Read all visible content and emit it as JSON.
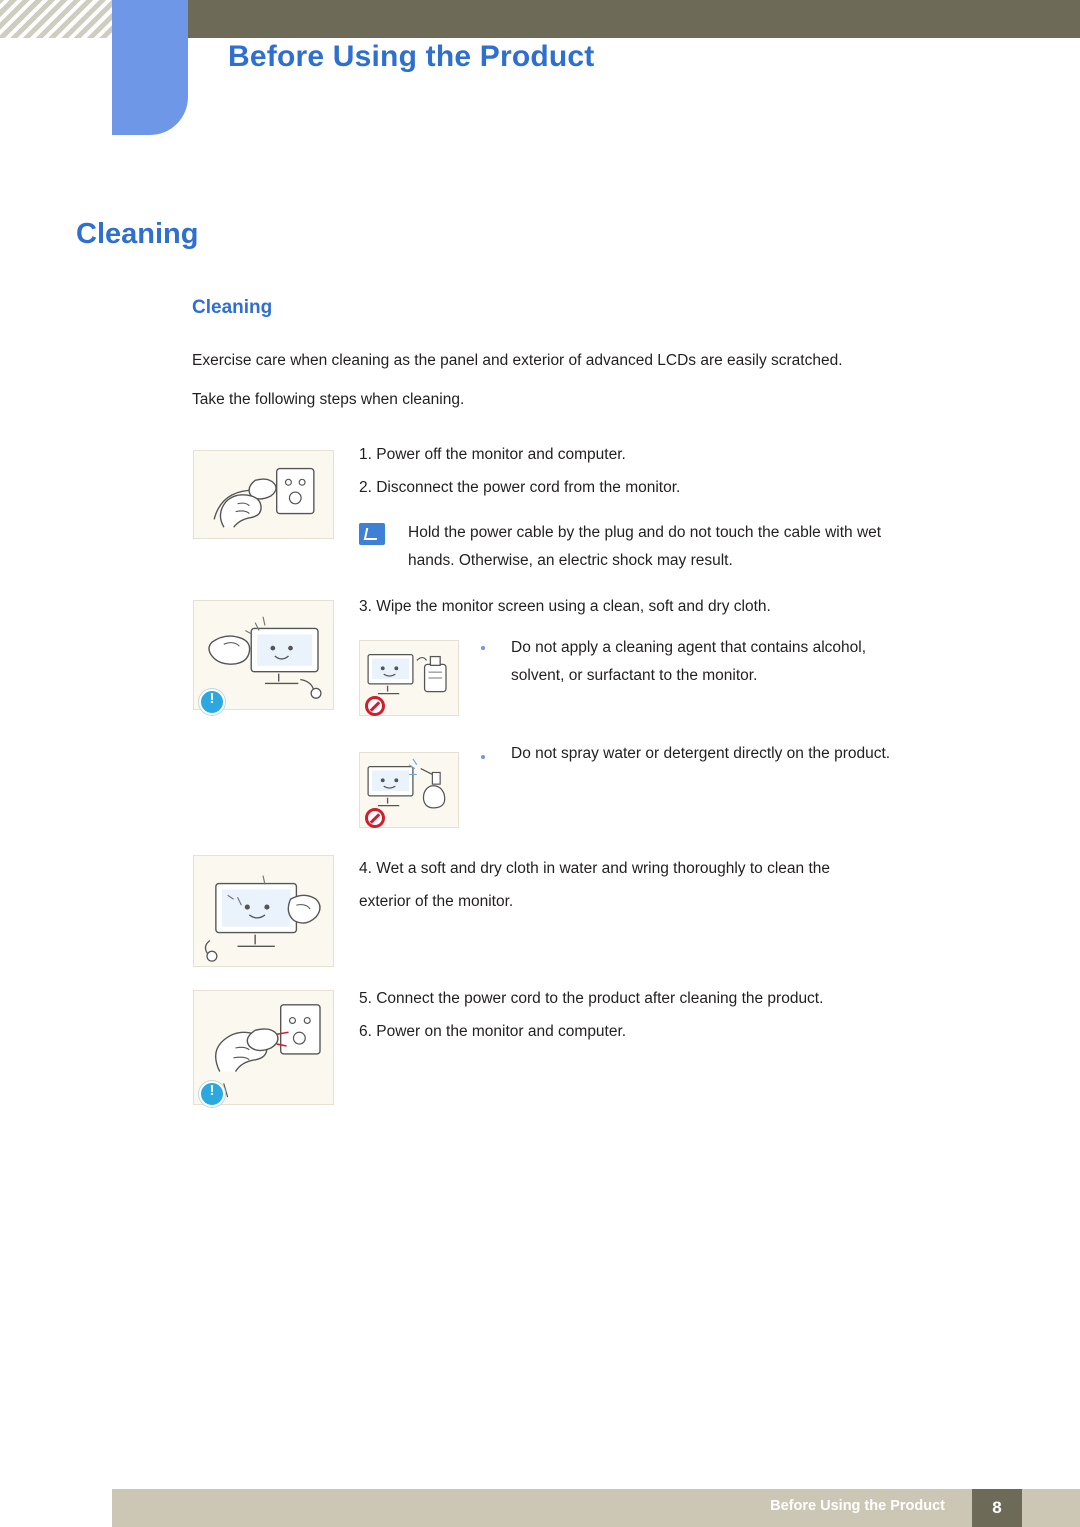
{
  "header": {
    "title": "Before Using the Product"
  },
  "page": {
    "title": "Cleaning",
    "section_title": "Cleaning",
    "intro_line1": "Exercise care when cleaning as the panel and exterior of advanced LCDs are easily scratched.",
    "intro_line2": "Take the following steps when cleaning.",
    "steps": [
      {
        "id": "step1",
        "text": "1. Power off the monitor and computer."
      },
      {
        "id": "step2",
        "text": "2. Disconnect the power cord from the monitor."
      },
      {
        "id": "step3",
        "text": "3. Wipe the monitor screen using a clean, soft and dry cloth."
      },
      {
        "id": "step4",
        "text": "4. Wet a soft and dry cloth in water and wring thoroughly to clean the\nexterior of the monitor."
      },
      {
        "id": "step5",
        "text": "5. Connect the power cord to the product after cleaning the product."
      },
      {
        "id": "step6",
        "text": "6. Power on the monitor and computer."
      }
    ],
    "note": "Hold the power cable by the plug and do not touch the cable with wet\nhands. Otherwise, an electric shock may result.",
    "bullets": [
      "Do not apply a cleaning agent that contains alcohol,\nsolvent, or surfactant to the monitor.",
      "Do not spray water or detergent directly on the product."
    ],
    "figures": [
      {
        "id": "fig-unplug",
        "alt": "hand unplugging power cord from wall socket"
      },
      {
        "id": "fig-wipe-screen",
        "alt": "hand wiping monitor screen with cloth"
      },
      {
        "id": "fig-no-cleaner",
        "alt": "prohibited: cleaning agent bottle near monitor"
      },
      {
        "id": "fig-no-spray",
        "alt": "prohibited: spraying water on monitor"
      },
      {
        "id": "fig-wipe-exterior",
        "alt": "wiping monitor exterior with damp cloth"
      },
      {
        "id": "fig-plug-in",
        "alt": "hand plugging power cord into wall socket"
      }
    ],
    "icons": {
      "note": "note-pencil-icon",
      "warning": "warning-exclamation-icon",
      "prohibited": "prohibition-icon"
    }
  },
  "footer": {
    "text": "Before Using the Product",
    "page_number": "8"
  },
  "colors": {
    "accent_blue": "#2f6fd0",
    "tab_blue": "#6f97e8",
    "header_band": "#6d6a58",
    "footer_band": "#ccc6b4"
  }
}
